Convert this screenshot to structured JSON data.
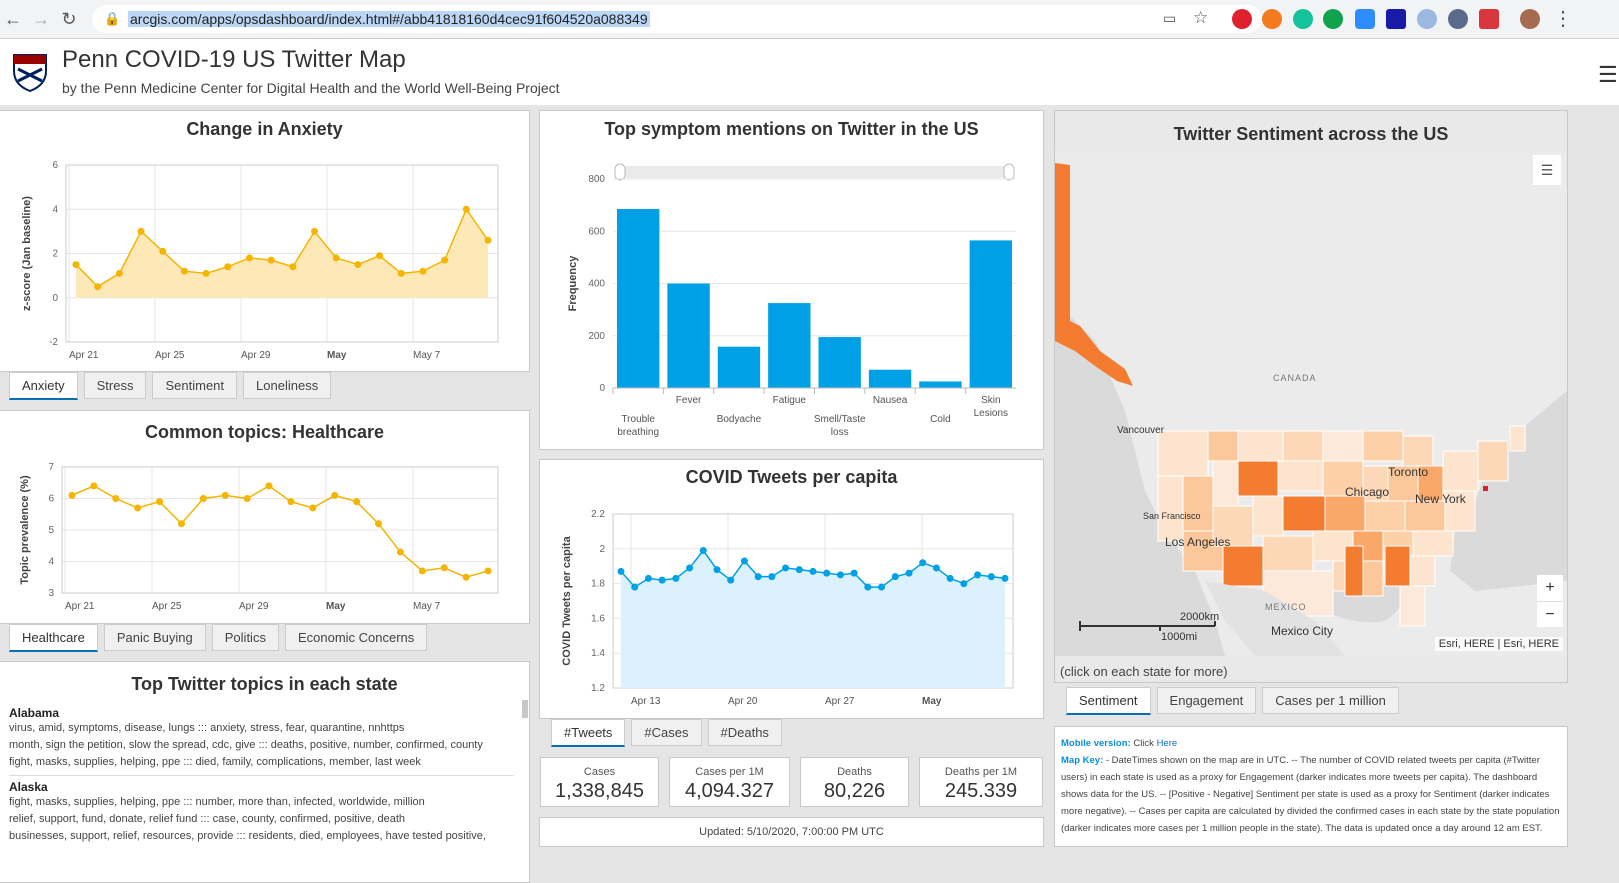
{
  "browser": {
    "url": "arcgis.com/apps/opsdashboard/index.html#/abb41818160d4cec91f604520a088349"
  },
  "header": {
    "title": "Penn COVID-19 US Twitter Map",
    "subtitle": "by the Penn Medicine Center for Digital Health and the World Well-Being Project"
  },
  "anxiety": {
    "title": "Change in Anxiety",
    "tabs": [
      "Anxiety",
      "Stress",
      "Sentiment",
      "Loneliness"
    ],
    "chart_data": {
      "type": "area",
      "title": "Change in Anxiety",
      "ylabel": "z-score (Jan baseline)",
      "ylim": [
        -2,
        6
      ],
      "yticks": [
        "6",
        "4",
        "2",
        "0",
        "-2"
      ],
      "xticks": [
        "Apr 21",
        "Apr 25",
        "Apr 29",
        "May",
        "May 7"
      ],
      "values": [
        1.5,
        0.5,
        1.1,
        3.0,
        2.1,
        1.2,
        1.1,
        1.4,
        1.8,
        1.7,
        1.4,
        3.0,
        1.8,
        1.5,
        1.9,
        1.1,
        1.2,
        1.7,
        4.0,
        2.6
      ],
      "color": "#f5b400"
    }
  },
  "healthcare": {
    "title": "Common topics: Healthcare",
    "tabs": [
      "Healthcare",
      "Panic Buying",
      "Politics",
      "Economic Concerns"
    ],
    "chart_data": {
      "type": "line",
      "title": "Common topics: Healthcare",
      "ylabel": "Topic prevalence (%)",
      "ylim": [
        3,
        7
      ],
      "yticks": [
        "7",
        "6",
        "5",
        "4",
        "3"
      ],
      "xticks": [
        "Apr 21",
        "Apr 25",
        "Apr 29",
        "May",
        "May 7"
      ],
      "values": [
        6.1,
        6.4,
        6.0,
        5.7,
        5.9,
        5.2,
        6.0,
        6.1,
        6.0,
        6.4,
        5.9,
        5.7,
        6.1,
        5.9,
        5.2,
        4.3,
        3.7,
        3.8,
        3.5,
        3.7
      ],
      "color": "#f5b400"
    }
  },
  "topics": {
    "title": "Top Twitter topics in each state",
    "states": [
      {
        "name": "Alabama",
        "lines": [
          "virus, amid, symptoms, disease, lungs ::: anxiety, stress, fear, quarantine, nnhttps",
          "month, sign the petition, slow the spread, cdc, give ::: deaths, positive, number, confirmed, county",
          "fight, masks, supplies, helping, ppe ::: died, family, complications, member, last week"
        ]
      },
      {
        "name": "Alaska",
        "lines": [
          "fight, masks, supplies, helping, ppe ::: number, more than, infected, worldwide, million",
          "relief, support, fund, donate, relief fund ::: case, county, confirmed, positive, death",
          "businesses, support, relief, resources, provide ::: residents, died, employees, have tested positive,"
        ]
      }
    ]
  },
  "symptoms": {
    "title": "Top symptom mentions on Twitter in the US",
    "chart_data": {
      "type": "bar",
      "title": "Top symptom mentions on Twitter in the US",
      "ylabel": "Frequency",
      "ylim": [
        0,
        800
      ],
      "yticks": [
        "800",
        "600",
        "400",
        "200",
        "0"
      ],
      "categories": [
        "Trouble breathing",
        "Fever",
        "Bodyache",
        "Fatigue",
        "Smell/Taste loss",
        "Nausea",
        "Cold",
        "Skin Lesions"
      ],
      "category_lines": [
        [
          "Trouble",
          "breathing"
        ],
        [
          "Fever"
        ],
        [
          "Bodyache"
        ],
        [
          "Fatigue"
        ],
        [
          "Smell/Taste",
          "loss"
        ],
        [
          "Nausea"
        ],
        [
          "Cold"
        ],
        [
          "Skin",
          "Lesions"
        ]
      ],
      "values": [
        685,
        400,
        158,
        325,
        195,
        70,
        25,
        565
      ],
      "color": "#00a0e6"
    }
  },
  "tweets": {
    "title": "COVID Tweets per capita",
    "tabs": [
      "#Tweets",
      "#Cases",
      "#Deaths"
    ],
    "chart_data": {
      "type": "area",
      "title": "COVID Tweets per capita",
      "ylabel": "COVID Tweets per capita",
      "ylim": [
        1.2,
        2.2
      ],
      "yticks": [
        "2.2",
        "2",
        "1.8",
        "1.6",
        "1.4",
        "1.2"
      ],
      "xticks": [
        "Apr 13",
        "Apr 20",
        "Apr 27",
        "May"
      ],
      "values": [
        1.87,
        1.78,
        1.83,
        1.82,
        1.83,
        1.89,
        1.99,
        1.88,
        1.82,
        1.93,
        1.84,
        1.84,
        1.89,
        1.88,
        1.87,
        1.86,
        1.85,
        1.86,
        1.78,
        1.78,
        1.84,
        1.86,
        1.92,
        1.89,
        1.83,
        1.8,
        1.85,
        1.84,
        1.83
      ],
      "color": "#00a0e6"
    }
  },
  "stats": [
    {
      "label": "Cases",
      "value": "1,338,845"
    },
    {
      "label": "Cases per 1M",
      "value": "4,094.327"
    },
    {
      "label": "Deaths",
      "value": "80,226"
    },
    {
      "label": "Deaths per 1M",
      "value": "245.339"
    }
  ],
  "updated": "Updated: 5/10/2020, 7:00:00 PM UTC",
  "map": {
    "title": "Twitter Sentiment across the US",
    "labels": [
      "CANADA",
      "Vancouver",
      "Toronto",
      "Chicago",
      "New York",
      "San Francisco",
      "Los Angeles",
      "MEXICO",
      "Mexico City"
    ],
    "scale_km": "2000km",
    "scale_mi": "1000mi",
    "attribution": "Esri, HERE | Esri, HERE",
    "zoom_in": "+",
    "zoom_out": "−",
    "hint": "(click on each state for more)",
    "tabs": [
      "Sentiment",
      "Engagement",
      "Cases per 1 million"
    ]
  },
  "info": {
    "mobile_label": "Mobile version:",
    "mobile_text": "Click ",
    "mobile_link": "Here",
    "key_label": "Map Key:",
    "key_text": " - DateTimes shown on the map are in UTC. -- The number of COVID related tweets per capita (#Twitter users) in each state is used as a proxy for Engagement (darker indicates more tweets per capita). The dashboard shows data for the US. -- [Positive - Negative] Sentiment per state is used as a proxy for Sentiment (darker indicates more negative). -- Cases per capita are calculated by divided the confirmed cases in each state by the state population (darker indicates more cases per 1 million people in the state). The data is updated once a day around 12 am EST."
  }
}
